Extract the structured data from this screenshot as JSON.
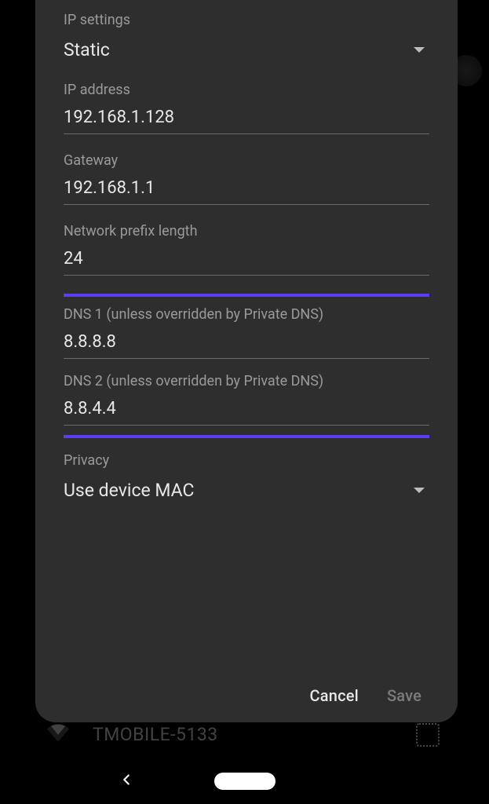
{
  "background": {
    "wifi_name": "TMOBILE-5133"
  },
  "dialog": {
    "ip_settings": {
      "label": "IP settings",
      "value": "Static"
    },
    "ip_address": {
      "label": "IP address",
      "value": "192.168.1.128"
    },
    "gateway": {
      "label": "Gateway",
      "value": "192.168.1.1"
    },
    "prefix_length": {
      "label": "Network prefix length",
      "value": "24"
    },
    "dns1": {
      "label": "DNS 1 (unless overridden by Private DNS)",
      "value": "8.8.8.8"
    },
    "dns2": {
      "label": "DNS 2 (unless overridden by Private DNS)",
      "value": "8.8.4.4"
    },
    "privacy": {
      "label": "Privacy",
      "value": "Use device MAC"
    },
    "actions": {
      "cancel": "Cancel",
      "save": "Save"
    }
  }
}
